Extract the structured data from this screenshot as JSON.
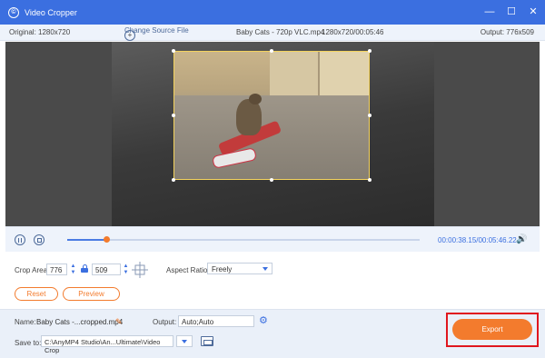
{
  "window": {
    "title": "Video Cropper",
    "logo_glyph": "©",
    "minimize": "—",
    "maximize": "☐",
    "close": "✕"
  },
  "info_bar": {
    "original": "Original: 1280x720",
    "change_source": "Change Source File",
    "file_name": "Baby Cats - 720p VLC.mp4",
    "resolution_duration": "1280x720/00:05:46",
    "output": "Output: 776x509"
  },
  "playback": {
    "time": "00:00:38.15/00:05:46.22",
    "progress": 0.11,
    "volume_glyph": "🔊"
  },
  "crop": {
    "crop_area_label": "Crop Area:",
    "width": "776",
    "height": "509",
    "aspect_ratio_label": "Aspect Ratio:",
    "aspect_ratio_value": "Freely",
    "reset_label": "Reset",
    "preview_label": "Preview"
  },
  "footer": {
    "name_label": "Name:",
    "name_value": "Baby Cats -...cropped.mp4",
    "output_label": "Output:",
    "output_value": "Auto;Auto",
    "save_to_label": "Save to:",
    "save_path": "C:\\AnyMP4 Studio\\An...Ultimate\\Video Crop",
    "export_label": "Export"
  },
  "colors": {
    "title_bar": "#3b6fe0",
    "accent_orange": "#f37b2d",
    "highlight_red": "#e0161e",
    "crop_border": "#f4d35e"
  },
  "icons": [
    "logo-icon",
    "minimize-icon",
    "maximize-icon",
    "close-icon",
    "plus-circle-icon",
    "pause-icon",
    "stop-icon",
    "volume-icon",
    "lock-icon",
    "crosshair-icon",
    "chevron-down-icon",
    "pencil-icon",
    "gear-icon",
    "folder-icon"
  ]
}
